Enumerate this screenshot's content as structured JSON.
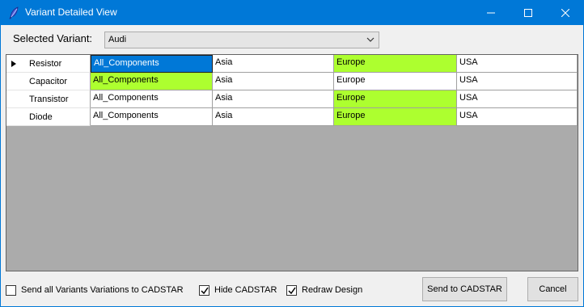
{
  "window": {
    "title": "Variant Detailed View"
  },
  "selector": {
    "label": "Selected Variant:",
    "value": "Audi"
  },
  "grid": {
    "rows": [
      {
        "name": "Resistor",
        "cells": [
          "All_Components",
          "Asia",
          "Europe",
          "USA"
        ]
      },
      {
        "name": "Capacitor",
        "cells": [
          "All_Components",
          "Asia",
          "Europe",
          "USA"
        ]
      },
      {
        "name": "Transistor",
        "cells": [
          "All_Components",
          "Asia",
          "Europe",
          "USA"
        ]
      },
      {
        "name": "Diode",
        "cells": [
          "All_Components",
          "Asia",
          "Europe",
          "USA"
        ]
      }
    ],
    "highlight_color": "#adff2f",
    "selection_color": "#0078d7"
  },
  "options": {
    "send_all": {
      "label": "Send all Variants Variations to CADSTAR",
      "checked": false
    },
    "hide_cadstar": {
      "label": "Hide CADSTAR",
      "checked": true
    },
    "redraw_design": {
      "label": "Redraw Design",
      "checked": true
    }
  },
  "buttons": {
    "send": "Send to CADSTAR",
    "cancel": "Cancel"
  }
}
